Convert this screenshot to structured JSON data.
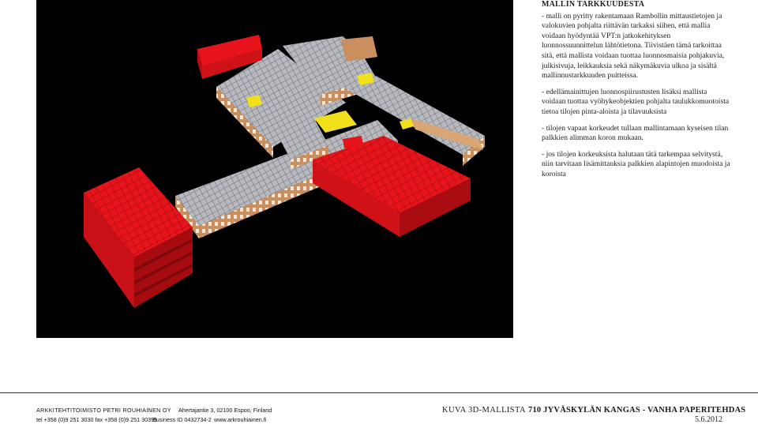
{
  "notes": {
    "heading": "MALLIN TARKKUUDESTA",
    "paragraphs": [
      "- malli on pyritty rakentamaan Rambollin mittaustietojen ja valokuvien pohjalta riittävän tarkaksi siihen, että mallia voidaan hyödyntää VPT:n jatkokehityksen luonnossuunnittelun lähtötietona. Tiivistäen tämä tarkoittaa sitä, että mallista voidaan tuottaa luonnosmaisia pohjakuvia, julkisivuja, leikkauksia sekä näkymäkuvia ulkoa ja sisältä mallinnustarkkuuden puitteissa.",
      "- edellämainittujen luonnospiirustusten lisäksi mallista voidaan tuottaa vyöhykeobjektien pohjalta taulukkomuotoista tietoa tilojen pinta-aloista ja tilavuuksista",
      "- tilojen vapaat korkeudet tullaan mallintamaan kyseisen tilan palkkien alimman koron mukaan.",
      "- jos tilojen korkeuksista halutaan tätä tarkempaa selvitystä, niin tarvitaan lisämittauksia palkkien alapintojen muodoista ja koroista"
    ]
  },
  "footer": {
    "firm_name": "ARKKITEHTITOIMISTO PETRI ROUHIAINEN OY",
    "phone": "tel +358 (0)9 251 3030 fax +358 (0)9 251 30395",
    "address": "Ahertajantie 3, 02100 Espoo, Finland",
    "business_id": "Business ID 0432734-2",
    "website": "www.arkrouhiainen.fi",
    "drawing_kind": "KUVA 3D-MALLISTA",
    "project_title": "710 JYVÄSKYLÄN KANGAS - VANHA PAPERITEHDAS",
    "date": "5.6.2012"
  },
  "colors": {
    "background": "#000000",
    "zone_red": "#e8141b",
    "facade_tan": "#c98f5f",
    "floor_grey": "#b4b6bb",
    "highlight_yellow": "#f2e11a"
  }
}
